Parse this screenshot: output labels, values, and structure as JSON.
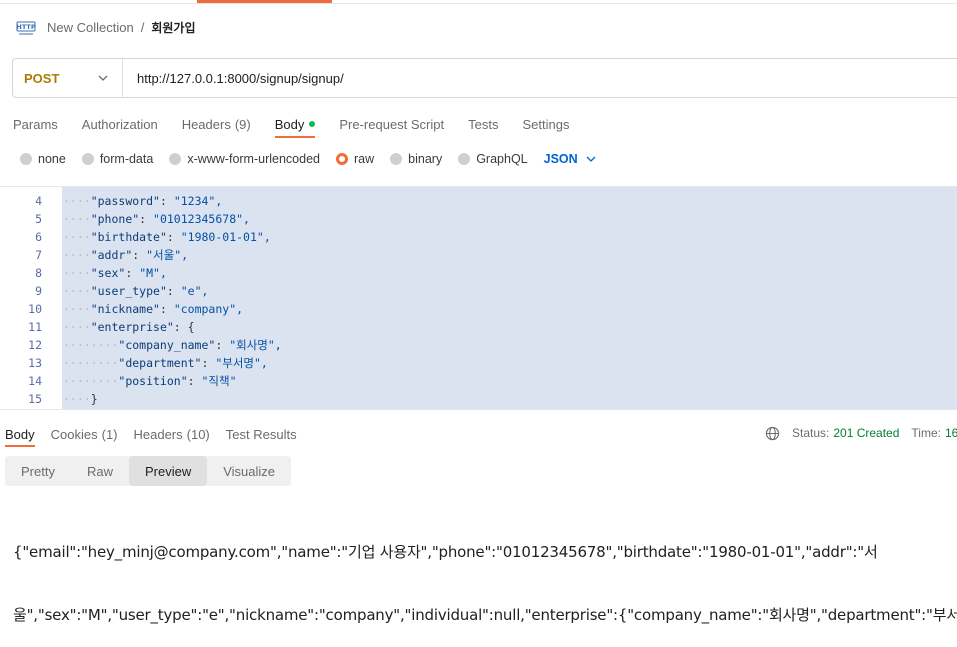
{
  "breadcrumb": {
    "collection": "New Collection",
    "separator": "/",
    "request": "회원가입"
  },
  "request": {
    "method": "POST",
    "url": "http://127.0.0.1:8000/signup/signup/"
  },
  "request_tabs": [
    {
      "label": "Params"
    },
    {
      "label": "Authorization"
    },
    {
      "label": "Headers",
      "count": "(9)"
    },
    {
      "label": "Body"
    },
    {
      "label": "Pre-request Script"
    },
    {
      "label": "Tests"
    },
    {
      "label": "Settings"
    }
  ],
  "body_types": [
    "none",
    "form-data",
    "x-www-form-urlencoded",
    "raw",
    "binary",
    "GraphQL"
  ],
  "selected_body_type": "raw",
  "format": "JSON",
  "code_lines": [
    {
      "n": "4",
      "ws": "····",
      "text": "\"password\": \"1234\","
    },
    {
      "n": "5",
      "ws": "····",
      "text": "\"phone\": \"01012345678\","
    },
    {
      "n": "6",
      "ws": "····",
      "text": "\"birthdate\": \"1980-01-01\","
    },
    {
      "n": "7",
      "ws": "····",
      "text": "\"addr\": \"서울\","
    },
    {
      "n": "8",
      "ws": "····",
      "text": "\"sex\": \"M\","
    },
    {
      "n": "9",
      "ws": "····",
      "text": "\"user_type\": \"e\","
    },
    {
      "n": "10",
      "ws": "····",
      "text": "\"nickname\": \"company\","
    },
    {
      "n": "11",
      "ws": "····",
      "text": "\"enterprise\": {"
    },
    {
      "n": "12",
      "ws": "········",
      "text": "\"company_name\": \"회사명\","
    },
    {
      "n": "13",
      "ws": "········",
      "text": "\"department\": \"부서명\","
    },
    {
      "n": "14",
      "ws": "········",
      "text": "\"position\": \"직책\""
    },
    {
      "n": "15",
      "ws": "····",
      "text": "}"
    }
  ],
  "response_tabs": [
    {
      "label": "Body"
    },
    {
      "label": "Cookies",
      "count": "(1)"
    },
    {
      "label": "Headers",
      "count": "(10)"
    },
    {
      "label": "Test Results"
    }
  ],
  "status": {
    "label": "Status:",
    "value": "201 Created",
    "time_label": "Time:",
    "time_value": "16"
  },
  "view_modes": [
    "Pretty",
    "Raw",
    "Preview",
    "Visualize"
  ],
  "active_view_mode": "Preview",
  "response_body": {
    "line1": "{\"email\":\"hey_minj@company.com\",\"name\":\"기업 사용자\",\"phone\":\"01012345678\",\"birthdate\":\"1980-01-01\",\"addr\":\"서",
    "line2": "울\",\"sex\":\"M\",\"user_type\":\"e\",\"nickname\":\"company\",\"individual\":null,\"enterprise\":{\"company_name\":\"회사명\",\"department\":\"부서명\",\""
  },
  "colors": {
    "accent": "#f26b3a",
    "method_post": "#ad7a03",
    "status_ok": "#007f31",
    "link_blue": "#0265d2",
    "modified_dot": "#0cbb52"
  }
}
